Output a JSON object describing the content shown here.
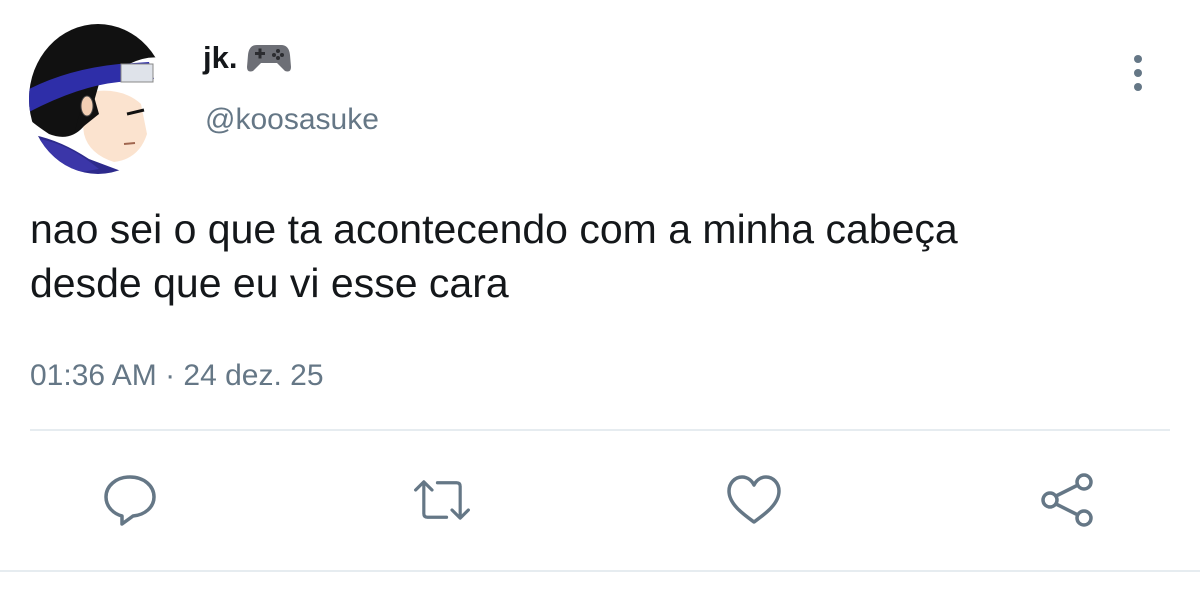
{
  "tweet": {
    "display_name": "jk.",
    "name_emoji": "video-game-controller-icon",
    "handle": "@koosasuke",
    "text_lines": [
      "nao sei o que ta acontecendo com a minha cabeça",
      "desde que eu vi esse cara"
    ],
    "timestamp": "01:36 AM · 24 dez. 25"
  },
  "actions": {
    "reply": "reply-icon",
    "retweet": "retweet-icon",
    "like": "heart-icon",
    "share": "share-icon"
  },
  "colors": {
    "text_primary": "#14171a",
    "text_secondary": "#657786",
    "icon": "#657786",
    "divider": "#e6ecf0"
  }
}
